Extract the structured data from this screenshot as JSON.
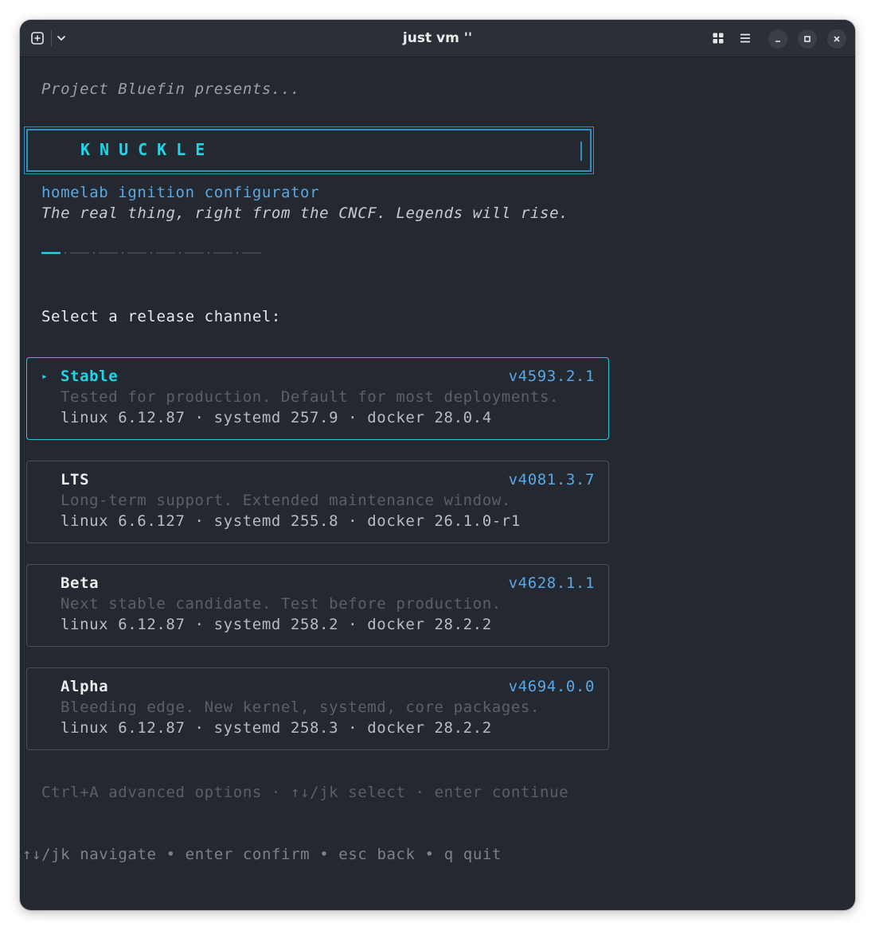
{
  "window": {
    "title": "just vm ''"
  },
  "terminal": {
    "presents": "Project Bluefin presents...",
    "logo": "KNUCKLE",
    "subtitle": "homelab ignition configurator",
    "tagline": "The real thing, right from the CNCF. Legends will rise.",
    "progress": {
      "current_step": 1,
      "total_steps": 8
    },
    "prompt": "Select a release channel:",
    "channels": [
      {
        "name": "Stable",
        "version": "v4593.2.1",
        "description": "Tested for production. Default for most deployments.",
        "specs": "linux 6.12.87 · systemd 257.9 · docker 28.0.4",
        "selected": true
      },
      {
        "name": "LTS",
        "version": "v4081.3.7",
        "description": "Long-term support. Extended maintenance window.",
        "specs": "linux 6.6.127 · systemd 255.8 · docker 26.1.0-r1",
        "selected": false
      },
      {
        "name": "Beta",
        "version": "v4628.1.1",
        "description": "Next stable candidate. Test before production.",
        "specs": "linux 6.12.87 · systemd 258.2 · docker 28.2.2",
        "selected": false
      },
      {
        "name": "Alpha",
        "version": "v4694.0.0",
        "description": "Bleeding edge. New kernel, systemd, core packages.",
        "specs": "linux 6.12.87 · systemd 258.3 · docker 28.2.2",
        "selected": false
      }
    ],
    "hint": "Ctrl+A advanced options · ↑↓/jk select · enter continue",
    "footer": "↑↓/jk navigate • enter confirm • esc back • q quit"
  },
  "icons": {
    "new_tab": "new-tab-icon",
    "dropdown": "chevron-down-icon",
    "grid": "grid-icon",
    "menu": "hamburger-menu-icon",
    "minimize": "minimize-icon",
    "maximize": "maximize-icon",
    "close": "close-icon",
    "pointer": "triangle-right-icon"
  },
  "colors": {
    "background": "#242830",
    "accent": "#1fd5e6",
    "version": "#58a8e6",
    "border": "#4a4e56"
  }
}
